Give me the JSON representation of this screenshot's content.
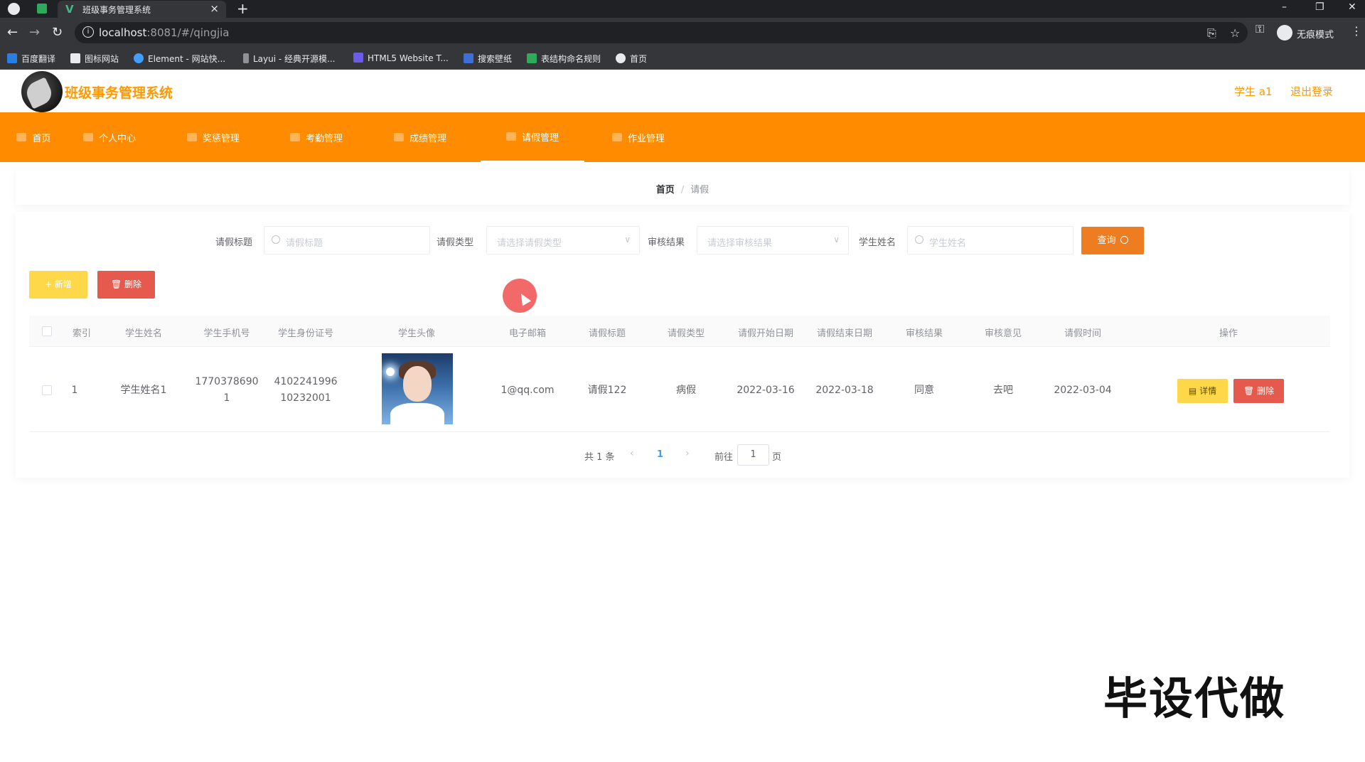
{
  "browser": {
    "tab_title": "班级事务管理系统",
    "url_host": "localhost",
    "url_rest": ":8081/#/qingjia",
    "incognito_label": "无痕模式",
    "bookmarks": [
      "百度翻译",
      "图标网站",
      "Element - 网站快...",
      "Layui - 经典开源模...",
      "HTML5 Website T...",
      "搜索壁纸",
      "表结构命名规则",
      "首页"
    ]
  },
  "header": {
    "title": "班级事务管理系统",
    "user": "学生 a1",
    "logout": "退出登录"
  },
  "nav": {
    "items": [
      "首页",
      "个人中心",
      "奖惩管理",
      "考勤管理",
      "成绩管理",
      "请假管理",
      "作业管理"
    ],
    "active": "请假管理"
  },
  "breadcrumb": {
    "home": "首页",
    "current": "请假"
  },
  "filters": {
    "title_label": "请假标题",
    "title_placeholder": "请假标题",
    "type_label": "请假类型",
    "type_placeholder": "请选择请假类型",
    "result_label": "审核结果",
    "result_placeholder": "请选择审核结果",
    "name_label": "学生姓名",
    "name_placeholder": "学生姓名",
    "query_button": "查询"
  },
  "actions": {
    "add": "+ 新增",
    "delete": "删除"
  },
  "table": {
    "headers": [
      "索引",
      "学生姓名",
      "学生手机号",
      "学生身份证号",
      "学生头像",
      "电子邮箱",
      "请假标题",
      "请假类型",
      "请假开始日期",
      "请假结束日期",
      "审核结果",
      "审核意见",
      "请假时间",
      "操作"
    ],
    "rows": [
      {
        "index": "1",
        "name": "学生姓名1",
        "phone_l1": "1770378690",
        "phone_l2": "1",
        "idcard_l1": "4102241996",
        "idcard_l2": "10232001",
        "email": "1@qq.com",
        "title": "请假122",
        "type": "病假",
        "start": "2022-03-16",
        "end": "2022-03-18",
        "result": "同意",
        "opinion": "去吧",
        "time": "2022-03-04",
        "detail_btn": "详情",
        "delete_btn": "删除"
      }
    ]
  },
  "pagination": {
    "total": "共 1 条",
    "current": "1",
    "goto": "前往",
    "page_value": "1",
    "page_suffix": "页"
  },
  "watermark": "毕设代做",
  "colors": {
    "nav_orange": "#ff8c00",
    "brand_orange": "#ff9900",
    "query_orange": "#ee7d21",
    "yellow_btn": "#ffd84a",
    "red_btn": "#e65a4e"
  }
}
